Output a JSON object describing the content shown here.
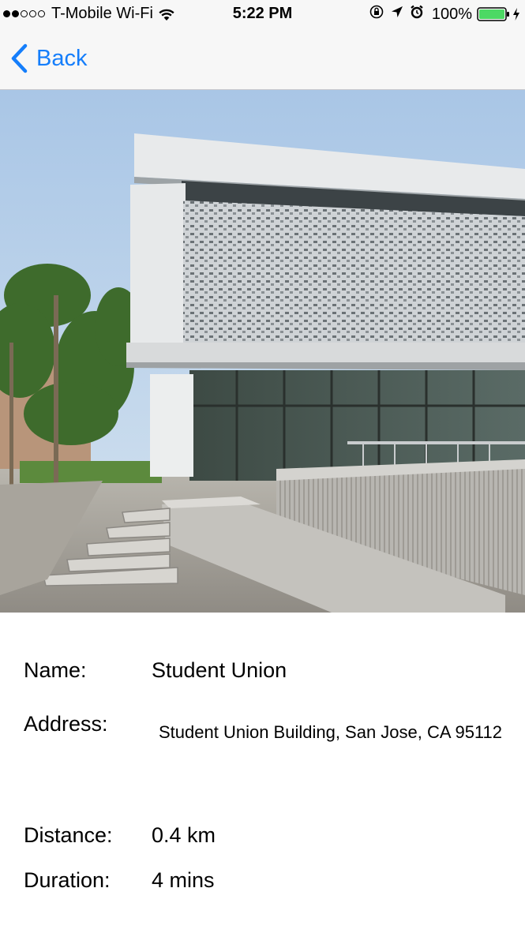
{
  "status_bar": {
    "signal_bars_filled": 2,
    "signal_bars_total": 5,
    "carrier": "T-Mobile Wi-Fi",
    "time": "5:22 PM",
    "battery_percent": "100%",
    "icons": [
      "wifi-icon",
      "orientation-lock-icon",
      "location-arrow-icon",
      "alarm-icon",
      "battery-icon",
      "charging-bolt-icon"
    ]
  },
  "nav": {
    "back_label": "Back",
    "accent_color": "#157efb"
  },
  "photo": {
    "subject": "building-photo"
  },
  "details": {
    "name_label": "Name:",
    "name_value": "Student Union",
    "address_label": "Address:",
    "address_value": "Student Union Building, San Jose, CA 95112",
    "distance_label": "Distance:",
    "distance_value": "0.4 km",
    "duration_label": "Duration:",
    "duration_value": "4 mins"
  }
}
